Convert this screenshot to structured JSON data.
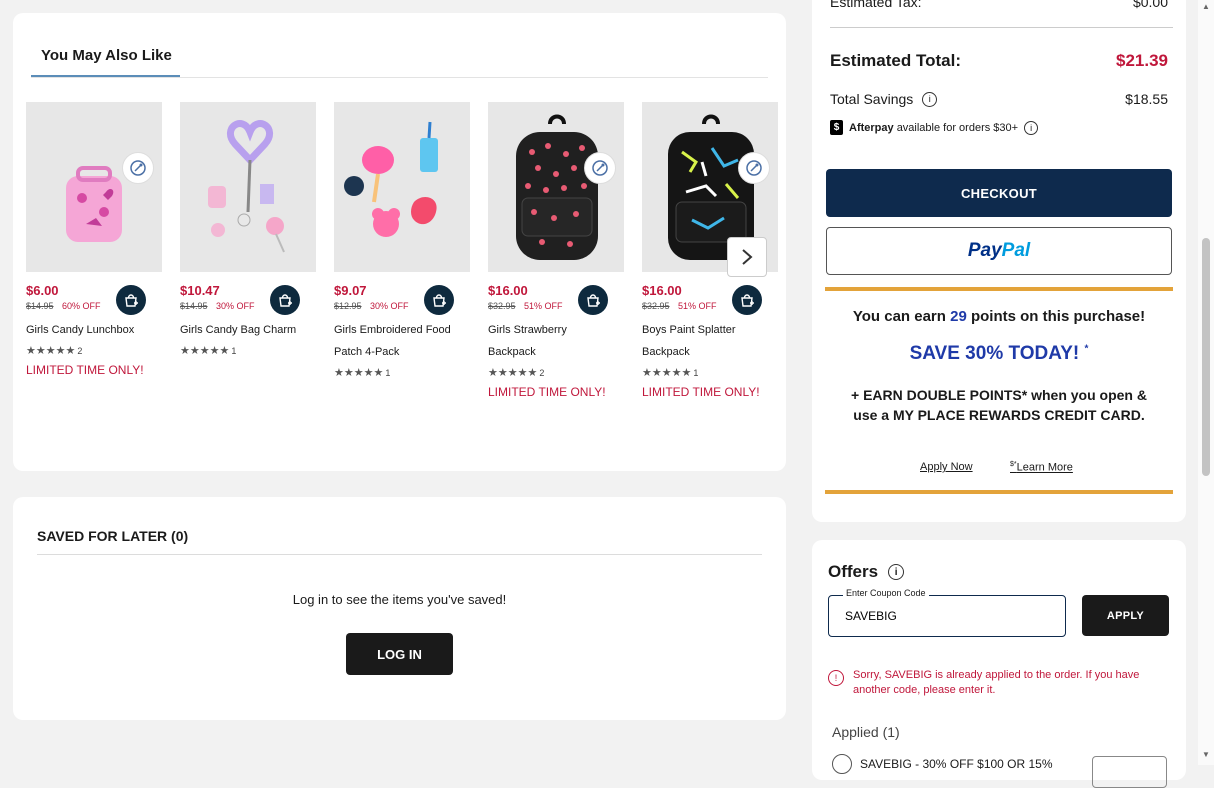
{
  "ymal": {
    "title": "You May Also Like",
    "products": [
      {
        "price": "$6.00",
        "was": "$14.95",
        "off": "60% OFF",
        "name_lines": [
          "Girls Candy Lunchbox"
        ],
        "stars": "★★★★★",
        "rating_count": "2",
        "limited": "LIMITED TIME ONLY!",
        "icon": "lunchbox"
      },
      {
        "price": "$10.47",
        "was": "$14.95",
        "off": "30% OFF",
        "name_lines": [
          "Girls Candy Bag Charm"
        ],
        "stars": "★★★★★",
        "rating_count": "1",
        "limited": "",
        "icon": "bag-charm"
      },
      {
        "price": "$9.07",
        "was": "$12.95",
        "off": "30% OFF",
        "name_lines": [
          "Girls Embroidered Food",
          "Patch 4-Pack"
        ],
        "stars": "★★★★★",
        "rating_count": "1",
        "limited": "",
        "icon": "patches"
      },
      {
        "price": "$16.00",
        "was": "$32.95",
        "off": "51% OFF",
        "name_lines": [
          "Girls Strawberry",
          "Backpack"
        ],
        "stars": "★★★★★",
        "rating_count": "2",
        "limited": "LIMITED TIME ONLY!",
        "icon": "backpack-strawberry"
      },
      {
        "price": "$16.00",
        "was": "$32.95",
        "off": "51% OFF",
        "name_lines": [
          "Boys Paint Splatter",
          "Backpack"
        ],
        "stars": "★★★★★",
        "rating_count": "1",
        "limited": "LIMITED TIME ONLY!",
        "icon": "backpack-splatter"
      }
    ]
  },
  "saved": {
    "title": "SAVED FOR LATER (0)",
    "message": "Log in to see the items you've saved!",
    "login_label": "LOG IN"
  },
  "summary": {
    "tax_label": "Estimated Tax:",
    "tax_value": "$0.00",
    "total_label": "Estimated Total:",
    "total_value": "$21.39",
    "savings_label": "Total Savings",
    "savings_value": "$18.55",
    "afterpay_brand": "Afterpay",
    "afterpay_text": "available for orders $30+",
    "checkout_label": "CHECKOUT",
    "paypal_1": "Pay",
    "paypal_2": "Pal"
  },
  "promo": {
    "earn_pre": "You can earn",
    "earn_points": "29",
    "earn_post": "points on this purchase!",
    "save_headline": "SAVE 30% TODAY!",
    "save_mark": "*",
    "double_text": "+ EARN DOUBLE POINTS* when you open & use a MY PLACE REWARDS CREDIT CARD.",
    "apply_now": "Apply Now",
    "learn_prefix": "$*",
    "learn_more": "Learn More"
  },
  "offers": {
    "title": "Offers",
    "coupon_label": "Enter Coupon Code",
    "coupon_value": "SAVEBIG",
    "apply_label": "APPLY",
    "error_text": "Sorry, SAVEBIG is already applied to the order. If you have another code, please enter it.",
    "applied_label": "Applied (1)",
    "applied_item": "SAVEBIG - 30% OFF $100 OR 15%"
  },
  "colors": {
    "accent_red": "#c0173b",
    "navy": "#0e2a4d",
    "promo_gold": "#e3a33a",
    "points_blue": "#1f3aa8"
  }
}
